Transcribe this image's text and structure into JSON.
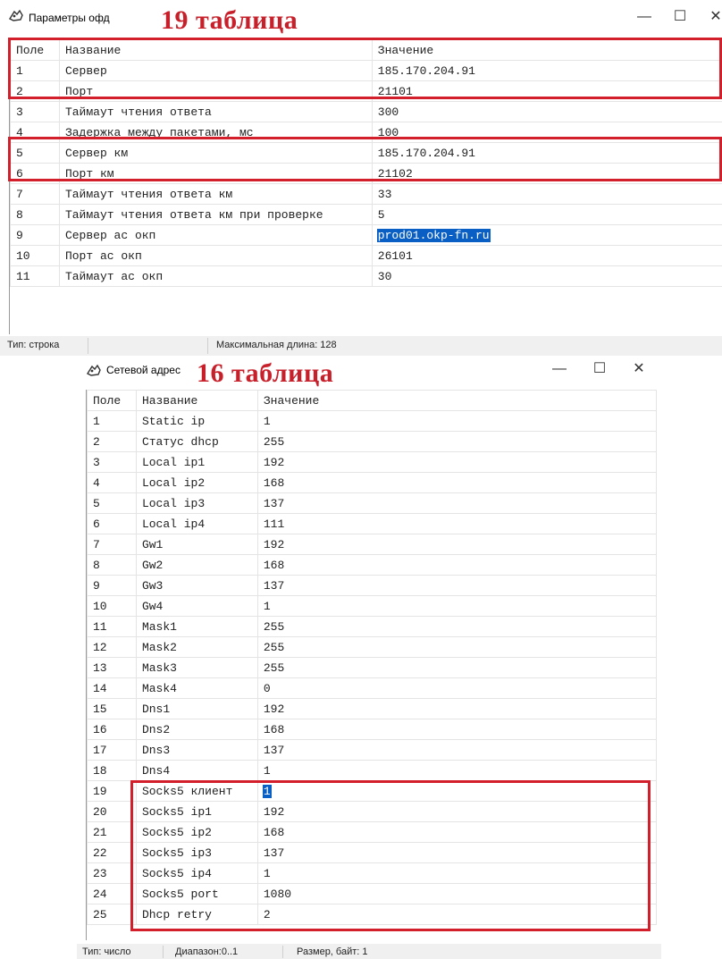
{
  "top_window": {
    "title": "Параметры офд",
    "annotation": "19 таблица",
    "controls": {
      "minimize": "—",
      "maximize": "☐",
      "close": "✕"
    },
    "columns": [
      "Поле",
      "Название",
      "Значение"
    ],
    "rows": [
      [
        "1",
        "Сервер",
        "185.170.204.91"
      ],
      [
        "2",
        "Порт",
        "21101"
      ],
      [
        "3",
        "Таймаут чтения ответа",
        "300"
      ],
      [
        "4",
        "Задержка между пакетами, мс",
        "100"
      ],
      [
        "5",
        "Сервер км",
        "185.170.204.91"
      ],
      [
        "6",
        "Порт км",
        "21102"
      ],
      [
        "7",
        "Таймаут чтения ответа км",
        "33"
      ],
      [
        "8",
        "Таймаут чтения ответа км при проверке",
        "5"
      ],
      [
        "9",
        "Сервер ас окп",
        "prod01.okp-fn.ru"
      ],
      [
        "10",
        "Порт ас окп",
        "26101"
      ],
      [
        "11",
        "Таймаут ас окп",
        "30"
      ]
    ],
    "selected_value_row": 9,
    "status": {
      "type": "Тип: строка",
      "max_length": "Максимальная длина: 128"
    }
  },
  "bottom_window": {
    "title": "Сетевой адрес",
    "annotation": "16 таблица",
    "controls": {
      "minimize": "—",
      "maximize": "☐",
      "close": "✕"
    },
    "columns": [
      "Поле",
      "Название",
      "Значение"
    ],
    "rows": [
      [
        "1",
        "Static ip",
        "1"
      ],
      [
        "2",
        "Статус dhcp",
        "255"
      ],
      [
        "3",
        "Local ip1",
        "192"
      ],
      [
        "4",
        "Local ip2",
        "168"
      ],
      [
        "5",
        "Local ip3",
        "137"
      ],
      [
        "6",
        "Local ip4",
        "111"
      ],
      [
        "7",
        "Gw1",
        "192"
      ],
      [
        "8",
        "Gw2",
        "168"
      ],
      [
        "9",
        "Gw3",
        "137"
      ],
      [
        "10",
        "Gw4",
        "1"
      ],
      [
        "11",
        "Mask1",
        "255"
      ],
      [
        "12",
        "Mask2",
        "255"
      ],
      [
        "13",
        "Mask3",
        "255"
      ],
      [
        "14",
        "Mask4",
        "0"
      ],
      [
        "15",
        "Dns1",
        "192"
      ],
      [
        "16",
        "Dns2",
        "168"
      ],
      [
        "17",
        "Dns3",
        "137"
      ],
      [
        "18",
        "Dns4",
        "1"
      ],
      [
        "19",
        "Socks5 клиент",
        "1"
      ],
      [
        "20",
        "Socks5 ip1",
        "192"
      ],
      [
        "21",
        "Socks5 ip2",
        "168"
      ],
      [
        "22",
        "Socks5 ip3",
        "137"
      ],
      [
        "23",
        "Socks5 ip4",
        "1"
      ],
      [
        "24",
        "Socks5 port",
        "1080"
      ],
      [
        "25",
        "Dhcp retry",
        "2"
      ]
    ],
    "selected_value_row": 19,
    "status": {
      "type": "Тип: число",
      "range": "Диапазон:0..1",
      "size": "Размер, байт: 1"
    }
  },
  "colors": {
    "highlight_box": "#d21f2b",
    "annotation": "#c8202a",
    "selection": "#0a5fc4"
  }
}
